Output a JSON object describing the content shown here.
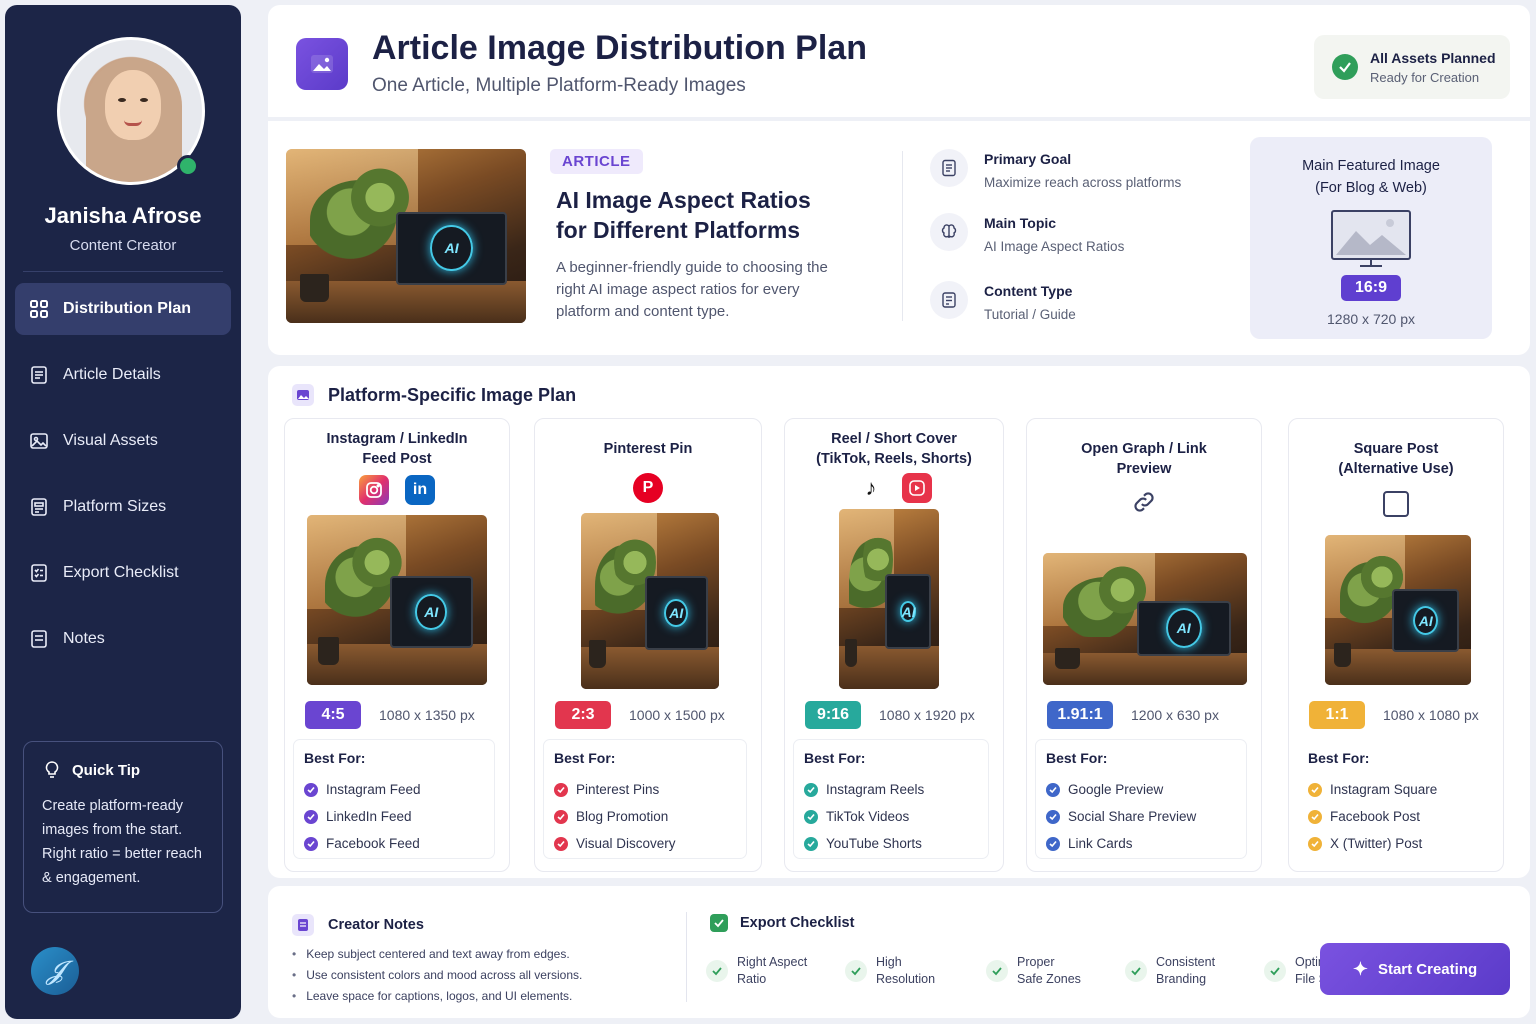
{
  "user": {
    "name": "Janisha Afrose",
    "role": "Content Creator",
    "online_color": "#2fb36b"
  },
  "nav": {
    "items": [
      {
        "label": "Distribution Plan",
        "icon": "grid-icon",
        "active": true
      },
      {
        "label": "Article Details",
        "icon": "document-icon",
        "active": false
      },
      {
        "label": "Visual Assets",
        "icon": "image-icon",
        "active": false
      },
      {
        "label": "Platform Sizes",
        "icon": "sizes-icon",
        "active": false
      },
      {
        "label": "Export Checklist",
        "icon": "checklist-icon",
        "active": false
      },
      {
        "label": "Notes",
        "icon": "notes-icon",
        "active": false
      }
    ]
  },
  "tip": {
    "title": "Quick Tip",
    "text": "Create platform-ready images from the start. Right ratio = better reach & engagement."
  },
  "header": {
    "title": "Article Image Distribution Plan",
    "subtitle": "One Article, Multiple Platform-Ready Images",
    "status_title": "All Assets Planned",
    "status_sub": "Ready for Creation"
  },
  "article": {
    "badge": "ARTICLE",
    "title_line1": "AI Image Aspect Ratios",
    "title_line2": "for Different Platforms",
    "description": "A beginner-friendly guide to choosing the right AI image aspect ratios for every platform and content type.",
    "meta": [
      {
        "label": "Primary Goal",
        "value": "Maximize reach across platforms",
        "icon": "document-icon"
      },
      {
        "label": "Main Topic",
        "value": "AI Image Aspect Ratios",
        "icon": "brain-icon"
      },
      {
        "label": "Content Type",
        "value": "Tutorial / Guide",
        "icon": "list-icon"
      }
    ],
    "featured": {
      "title_line1": "Main Featured Image",
      "title_line2": "(For Blog & Web)",
      "ratio": "16:9",
      "size": "1280 x 720 px"
    }
  },
  "plan": {
    "title": "Platform-Specific Image Plan",
    "best_for_label": "Best For:",
    "cards": [
      {
        "title_line1": "Instagram / LinkedIn",
        "title_line2": "Feed Post",
        "ratio": "4:5",
        "size": "1080 x 1350 px",
        "color": "#6a45d1",
        "items": [
          "Instagram Feed",
          "LinkedIn Feed",
          "Facebook Feed"
        ]
      },
      {
        "title_line1": "Pinterest Pin",
        "title_line2": "",
        "ratio": "2:3",
        "size": "1000 x 1500 px",
        "color": "#e2364e",
        "items": [
          "Pinterest Pins",
          "Blog Promotion",
          "Visual Discovery"
        ]
      },
      {
        "title_line1": "Reel / Short Cover",
        "title_line2": "(TikTok, Reels, Shorts)",
        "ratio": "9:16",
        "size": "1080 x 1920 px",
        "color": "#27a99c",
        "items": [
          "Instagram Reels",
          "TikTok Videos",
          "YouTube Shorts"
        ]
      },
      {
        "title_line1": "Open Graph / Link",
        "title_line2": "Preview",
        "ratio": "1.91:1",
        "size": "1200 x 630 px",
        "color": "#3f67c9",
        "items": [
          "Google Preview",
          "Social Share Preview",
          "Link Cards"
        ]
      },
      {
        "title_line1": "Square Post",
        "title_line2": "(Alternative Use)",
        "ratio": "1:1",
        "size": "1080 x 1080 px",
        "color": "#f0b238",
        "items": [
          "Instagram Square",
          "Facebook Post",
          "X (Twitter) Post"
        ]
      }
    ],
    "image_label": "AI"
  },
  "notes": {
    "title": "Creator Notes",
    "items": [
      "Keep subject centered and text away from edges.",
      "Use consistent colors and mood across all versions.",
      "Leave space for captions, logos, and UI elements."
    ]
  },
  "checklist": {
    "title": "Export Checklist",
    "items": [
      {
        "line1": "Right Aspect",
        "line2": "Ratio"
      },
      {
        "line1": "High",
        "line2": "Resolution"
      },
      {
        "line1": "Proper",
        "line2": "Safe Zones"
      },
      {
        "line1": "Consistent",
        "line2": "Branding"
      },
      {
        "line1": "Optimized",
        "line2": "File Size"
      }
    ]
  },
  "cta": {
    "label": "Start Creating"
  },
  "colors": {
    "accent": "#5b3bc9",
    "sidebar": "#1c2547",
    "success": "#2f9e5a"
  }
}
